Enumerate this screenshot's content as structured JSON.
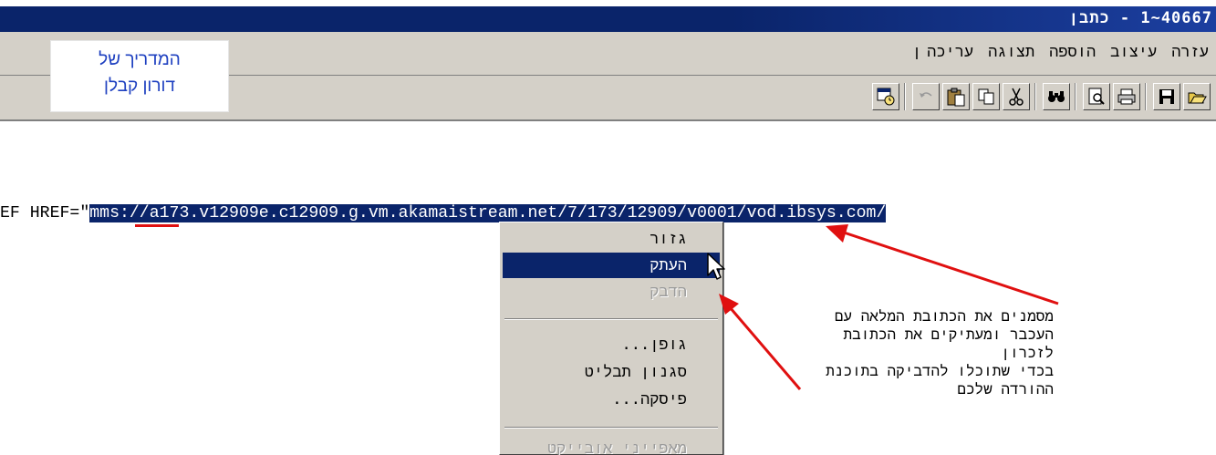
{
  "window": {
    "title": "40667~1 - כתבן"
  },
  "menu": {
    "items": [
      "ן",
      "עריכה",
      "תצוגה",
      "הוספה",
      "עיצוב",
      "עזרה"
    ]
  },
  "toolbar": {
    "icons": [
      "open-icon",
      "save-icon",
      "print-icon",
      "print-preview-icon",
      "find-icon",
      "cut-icon",
      "copy-icon",
      "paste-icon",
      "undo-icon",
      "date-time-icon"
    ]
  },
  "guide": {
    "line1": "המדריך של",
    "line2": "דורון קבלן"
  },
  "document": {
    "prefix": "EF HREF=\"",
    "selected_url": "mms://a173.v12909e.c12909.g.vm.akamaistream.net/7/173/12909/v0001/vod.ibsys.com/"
  },
  "context_menu": {
    "cut": "גזור",
    "copy": "העתק",
    "paste": "הדבק",
    "font": "גופן...",
    "bullet_style": "סגנון תבליט",
    "paragraph": "פיסקה...",
    "object_properties": "מאפייני אובייקט"
  },
  "annotation": {
    "text": "מסמנים את הכתובת המלאה עם\nהעכבר ומעתיקים את הכתובת\nלזכרון\nבכדי שתוכלו להדביקה בתוכנת\nההורדה שלכם"
  },
  "colors": {
    "selection": "#0a246a",
    "arrow": "#e01010",
    "guide_text": "#1e40c0"
  }
}
